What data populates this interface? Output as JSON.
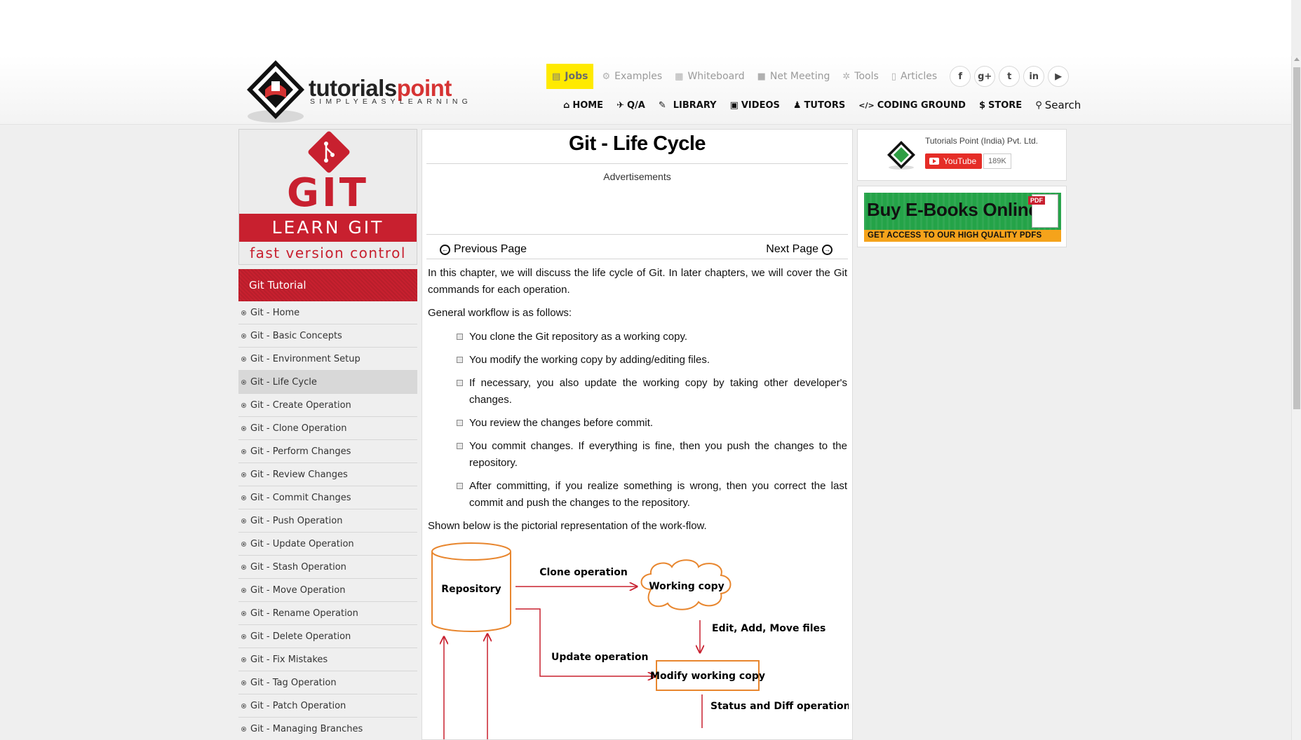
{
  "header": {
    "logo_text_dark": "tutorials",
    "logo_text_accent": "point",
    "logo_tagline": "SIMPLYEASYLEARNING",
    "top_links": [
      {
        "label": "Jobs",
        "icon": "briefcase-icon"
      },
      {
        "label": "Examples",
        "icon": "gears-icon"
      },
      {
        "label": "Whiteboard",
        "icon": "whiteboard-icon"
      },
      {
        "label": "Net Meeting",
        "icon": "video-camera-icon"
      },
      {
        "label": "Tools",
        "icon": "gear-icon"
      },
      {
        "label": "Articles",
        "icon": "document-icon"
      }
    ],
    "social": [
      "f",
      "g+",
      "t",
      "in",
      "▶"
    ],
    "nav": [
      {
        "label": "HOME",
        "icon": "⌂"
      },
      {
        "label": "Q/A",
        "icon": "✈"
      },
      {
        "label": "LIBRARY",
        "icon": "✎"
      },
      {
        "label": "VIDEOS",
        "icon": "▣"
      },
      {
        "label": "TUTORS",
        "icon": "♟"
      },
      {
        "label": "CODING GROUND",
        "icon": "</>"
      },
      {
        "label": "STORE",
        "icon": "$"
      }
    ],
    "search_label": "Search"
  },
  "sidebar": {
    "banner": {
      "title": "GIT",
      "subtitle": "LEARN GIT",
      "tagline": "fast version control"
    },
    "heading": "Git Tutorial",
    "items": [
      {
        "label": "Git - Home"
      },
      {
        "label": "Git - Basic Concepts"
      },
      {
        "label": "Git - Environment Setup"
      },
      {
        "label": "Git - Life Cycle",
        "active": true
      },
      {
        "label": "Git - Create Operation"
      },
      {
        "label": "Git - Clone Operation"
      },
      {
        "label": "Git - Perform Changes"
      },
      {
        "label": "Git - Review Changes"
      },
      {
        "label": "Git - Commit Changes"
      },
      {
        "label": "Git - Push Operation"
      },
      {
        "label": "Git - Update Operation"
      },
      {
        "label": "Git - Stash Operation"
      },
      {
        "label": "Git - Move Operation"
      },
      {
        "label": "Git - Rename Operation"
      },
      {
        "label": "Git - Delete Operation"
      },
      {
        "label": "Git - Fix Mistakes"
      },
      {
        "label": "Git - Tag Operation"
      },
      {
        "label": "Git - Patch Operation"
      },
      {
        "label": "Git - Managing Branches"
      }
    ]
  },
  "main": {
    "title": "Git - Life Cycle",
    "ads_label": "Advertisements",
    "prev_label": "Previous Page",
    "next_label": "Next Page",
    "intro": "In this chapter, we will discuss the life cycle of Git. In later chapters, we will cover the Git commands for each operation.",
    "workflow_intro": "General workflow is as follows:",
    "steps": [
      "You clone the Git repository as a working copy.",
      "You modify the working copy by adding/editing files.",
      "If necessary, you also update the working copy by taking other developer's changes.",
      "You review the changes before commit.",
      "You commit changes. If everything is fine, then you push the changes to the repository.",
      "After committing, if you realize something is wrong, then you correct the last commit and push the changes to the repository."
    ],
    "diagram_intro": "Shown below is the pictorial representation of the work-flow.",
    "diagram": {
      "repository": "Repository",
      "clone_operation": "Clone operation",
      "working_copy": "Working copy",
      "edit_files": "Edit, Add, Move files",
      "update_operation": "Update operation",
      "modify_working_copy": "Modify working copy",
      "status_diff": "Status and Diff operation",
      "accent_color": "#e8862e",
      "arrow_color": "#c8202f"
    }
  },
  "right": {
    "yt_channel": "Tutorials Point (India) Pvt. Ltd.",
    "yt_button": "YouTube",
    "yt_count": "189K",
    "ebook_title": "Buy E-Books Online",
    "ebook_strip": "GET ACCESS TO OUR HIGH QUALITY PDFS",
    "ebook_pdf_tag": "PDF"
  }
}
